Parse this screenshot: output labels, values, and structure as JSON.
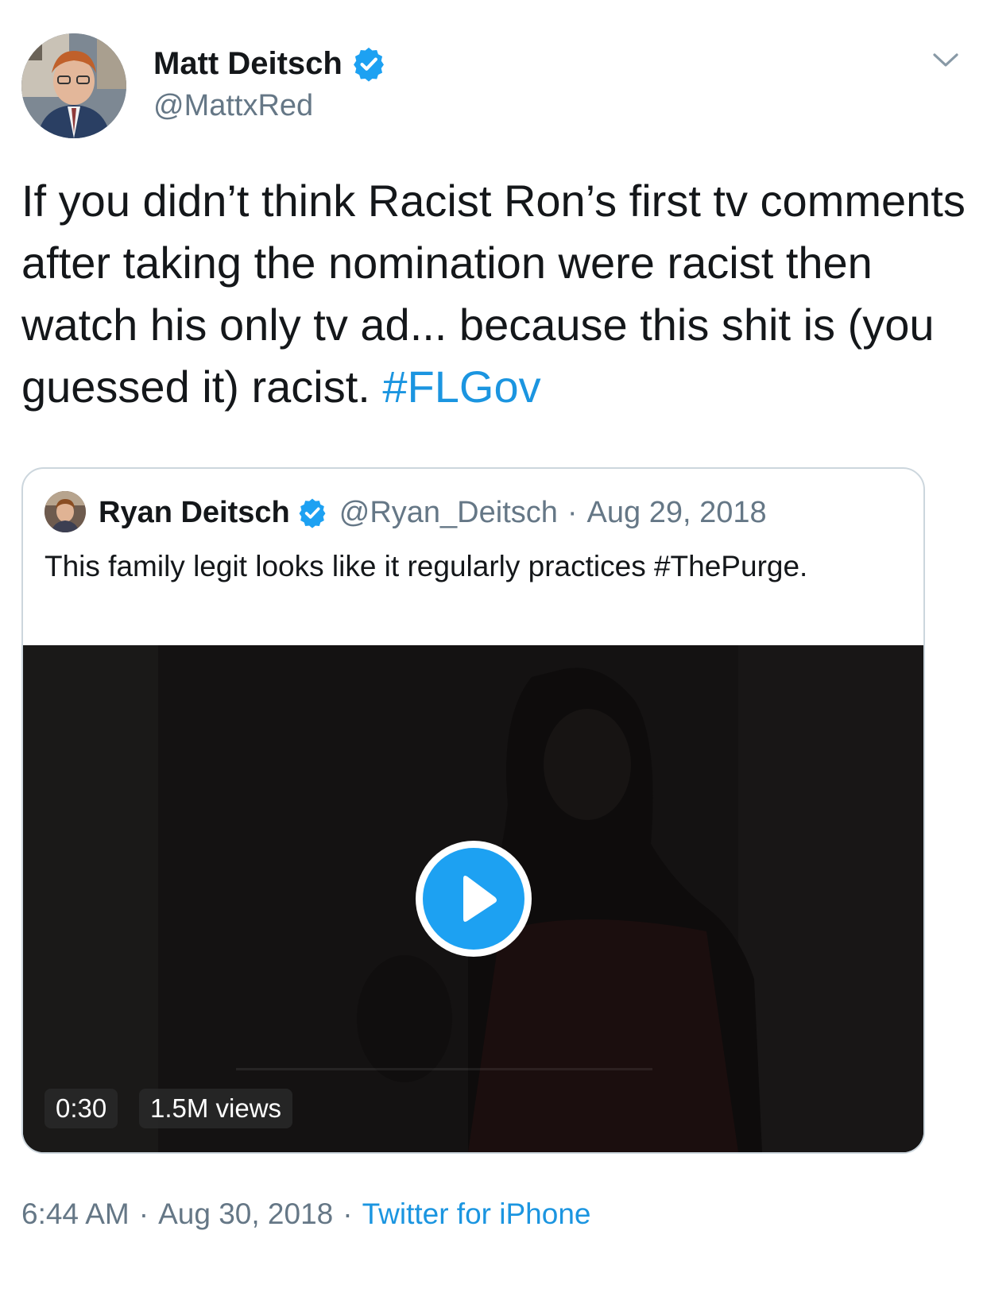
{
  "tweet": {
    "author_name": "Matt Deitsch",
    "author_handle": "@MattxRed",
    "text": "If you didn’t think Racist Ron’s first tv comments after taking the nomination were racist then watch his only tv ad... because this shit is (you guessed it) racist.",
    "hashtag": "#FLGov",
    "time": "6:44 AM",
    "date": "Aug 30, 2018",
    "separator": "·",
    "source": "Twitter for iPhone"
  },
  "quoted_tweet": {
    "author_name": "Ryan Deitsch",
    "author_handle": "@Ryan_Deitsch",
    "separator": "·",
    "date": "Aug 29, 2018",
    "text": "This family legit looks like it regularly practices #ThePurge.",
    "video": {
      "duration": "0:30",
      "views": "1.5M views",
      "progress": 0
    }
  },
  "icons": {
    "verified": "verified-badge-icon",
    "caret": "chevron-down-icon",
    "play": "play-icon"
  },
  "colors": {
    "link": "#1b95e0",
    "verified": "#1da1f2",
    "secondary_text": "#657786",
    "border": "#ccd6dd",
    "play_button": "#1da1f2"
  }
}
